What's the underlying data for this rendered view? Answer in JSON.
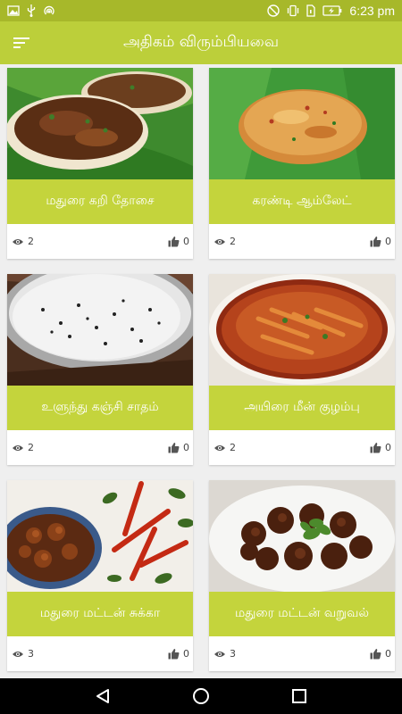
{
  "status_bar": {
    "time": "6:23 pm",
    "left_icons": [
      "gallery-icon",
      "usb-icon",
      "hotspot-icon"
    ],
    "right_icons": [
      "do-not-disturb-icon",
      "vibrate-icon",
      "sim-icon",
      "battery-charging-icon"
    ]
  },
  "app_bar": {
    "title": "அதிகம் விரும்பியவை",
    "menu_icon": "menu-icon",
    "color": "#bccf3a"
  },
  "theme": {
    "accent": "#c4d43c",
    "status": "#a7b82a",
    "background": "#efefef"
  },
  "recipes": [
    {
      "title": "மதுரை கறி தோசை",
      "views": "2",
      "likes": "0",
      "image": "kari-dosa-photo"
    },
    {
      "title": "கரண்டி ஆம்லேட்",
      "views": "2",
      "likes": "0",
      "image": "karandi-omelette-photo"
    },
    {
      "title": "உளுந்து கஞ்சி சாதம்",
      "views": "2",
      "likes": "0",
      "image": "ulundhu-kanji-photo"
    },
    {
      "title": "அயிரை மீன் குழம்பு",
      "views": "2",
      "likes": "0",
      "image": "ayirai-meen-kuzhambu-photo"
    },
    {
      "title": "மதுரை மட்டன் சுக்கா",
      "views": "3",
      "likes": "0",
      "image": "mutton-chukka-photo"
    },
    {
      "title": "மதுரை மட்டன் வறுவல்",
      "views": "3",
      "likes": "0",
      "image": "mutton-varuval-photo"
    }
  ],
  "nav_bar": {
    "buttons": [
      "back-icon",
      "home-icon",
      "recents-icon"
    ]
  }
}
